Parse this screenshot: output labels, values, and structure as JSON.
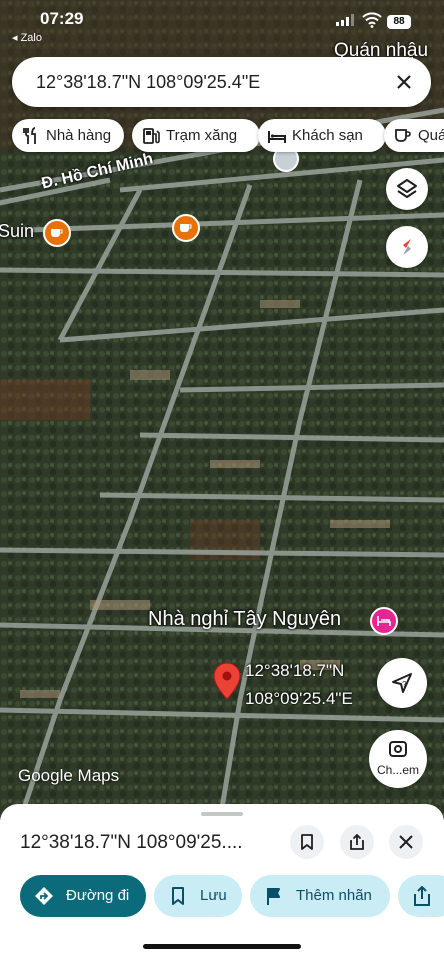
{
  "status_bar": {
    "time": "07:29",
    "back_app": "◂ Zalo",
    "battery": "88"
  },
  "search": {
    "query": "12°38'18.7\"N 108°09'25.4\"E"
  },
  "chips": [
    {
      "label": "Nhà hàng",
      "icon": "restaurant-icon"
    },
    {
      "label": "Trạm xăng",
      "icon": "gas-station-icon"
    },
    {
      "label": "Khách sạn",
      "icon": "hotel-icon"
    },
    {
      "label": "Quá",
      "icon": "cafe-icon"
    }
  ],
  "map": {
    "labels": {
      "top_right_place": "Quán nhậu",
      "road": "Đ. Hồ Chí Minh",
      "left_place": "Suin",
      "guesthouse": "Nhà nghỉ Tây Nguyên",
      "pin_lat": "12°38'18.7\"N",
      "pin_lng": "108°09'25.4\"E"
    },
    "watermark": "Google Maps",
    "street_view_label": "Ch...em"
  },
  "sheet": {
    "title": "12°38'18.7\"N 108°09'25....",
    "actions": [
      {
        "label": "Đường đi"
      },
      {
        "label": "Lưu"
      },
      {
        "label": "Thêm nhãn"
      }
    ]
  },
  "colors": {
    "accent": "#0b6b7a",
    "chip_bg": "#c9ecf5",
    "pin": "#ea4335",
    "hotel": "#e52592",
    "cafe": "#e8710a"
  }
}
